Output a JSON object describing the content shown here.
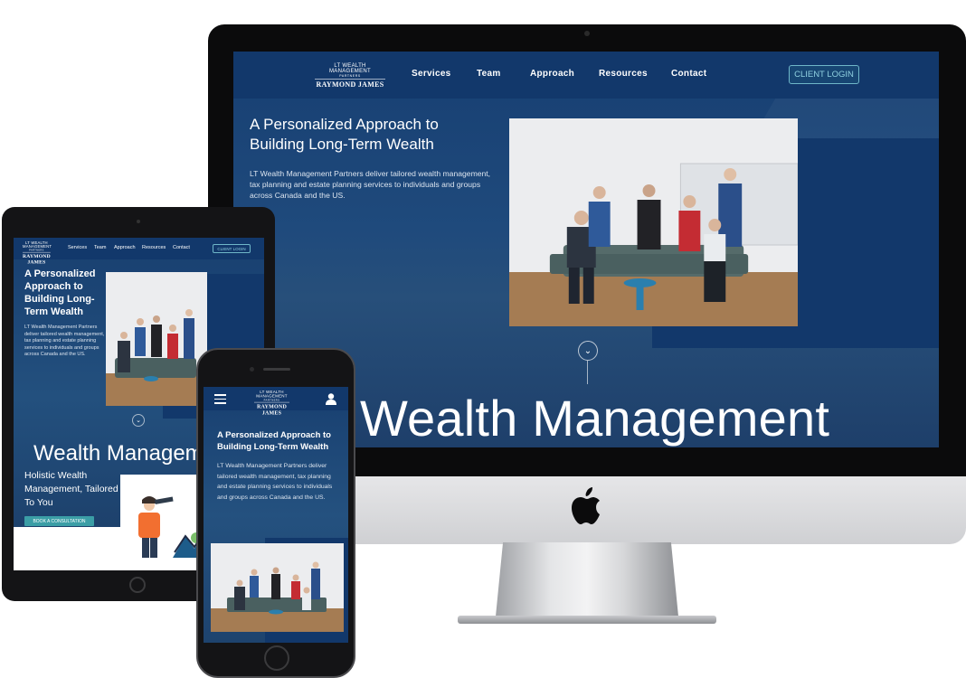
{
  "site": {
    "logo": {
      "mark": "LT WEALTH MANAGEMENT",
      "partners": "PARTNERS",
      "brand": "RAYMOND JAMES"
    },
    "nav": [
      "Services",
      "Team",
      "Approach",
      "Resources",
      "Contact"
    ],
    "client_login": "CLIENT LOGIN",
    "hero_title": "A Personalized Approach to Building Long-Term Wealth",
    "hero_sub": "LT Wealth Management Partners deliver tailored wealth management, tax planning and estate planning services to individuals and groups across Canada and the US.",
    "big_heading": "Wealth Management",
    "tablet_big_heading": "Wealth Managem",
    "holistic": "Holistic Wealth Management, Tailored To You",
    "book_button": "BOOK A CONSULTATION",
    "scroll_icon": "chevron-down"
  },
  "colors": {
    "navy": "#12386b",
    "hero_blue": "#1f4a7c",
    "accent_teal": "#3b9ea6",
    "login_border": "#6fb7c9"
  }
}
